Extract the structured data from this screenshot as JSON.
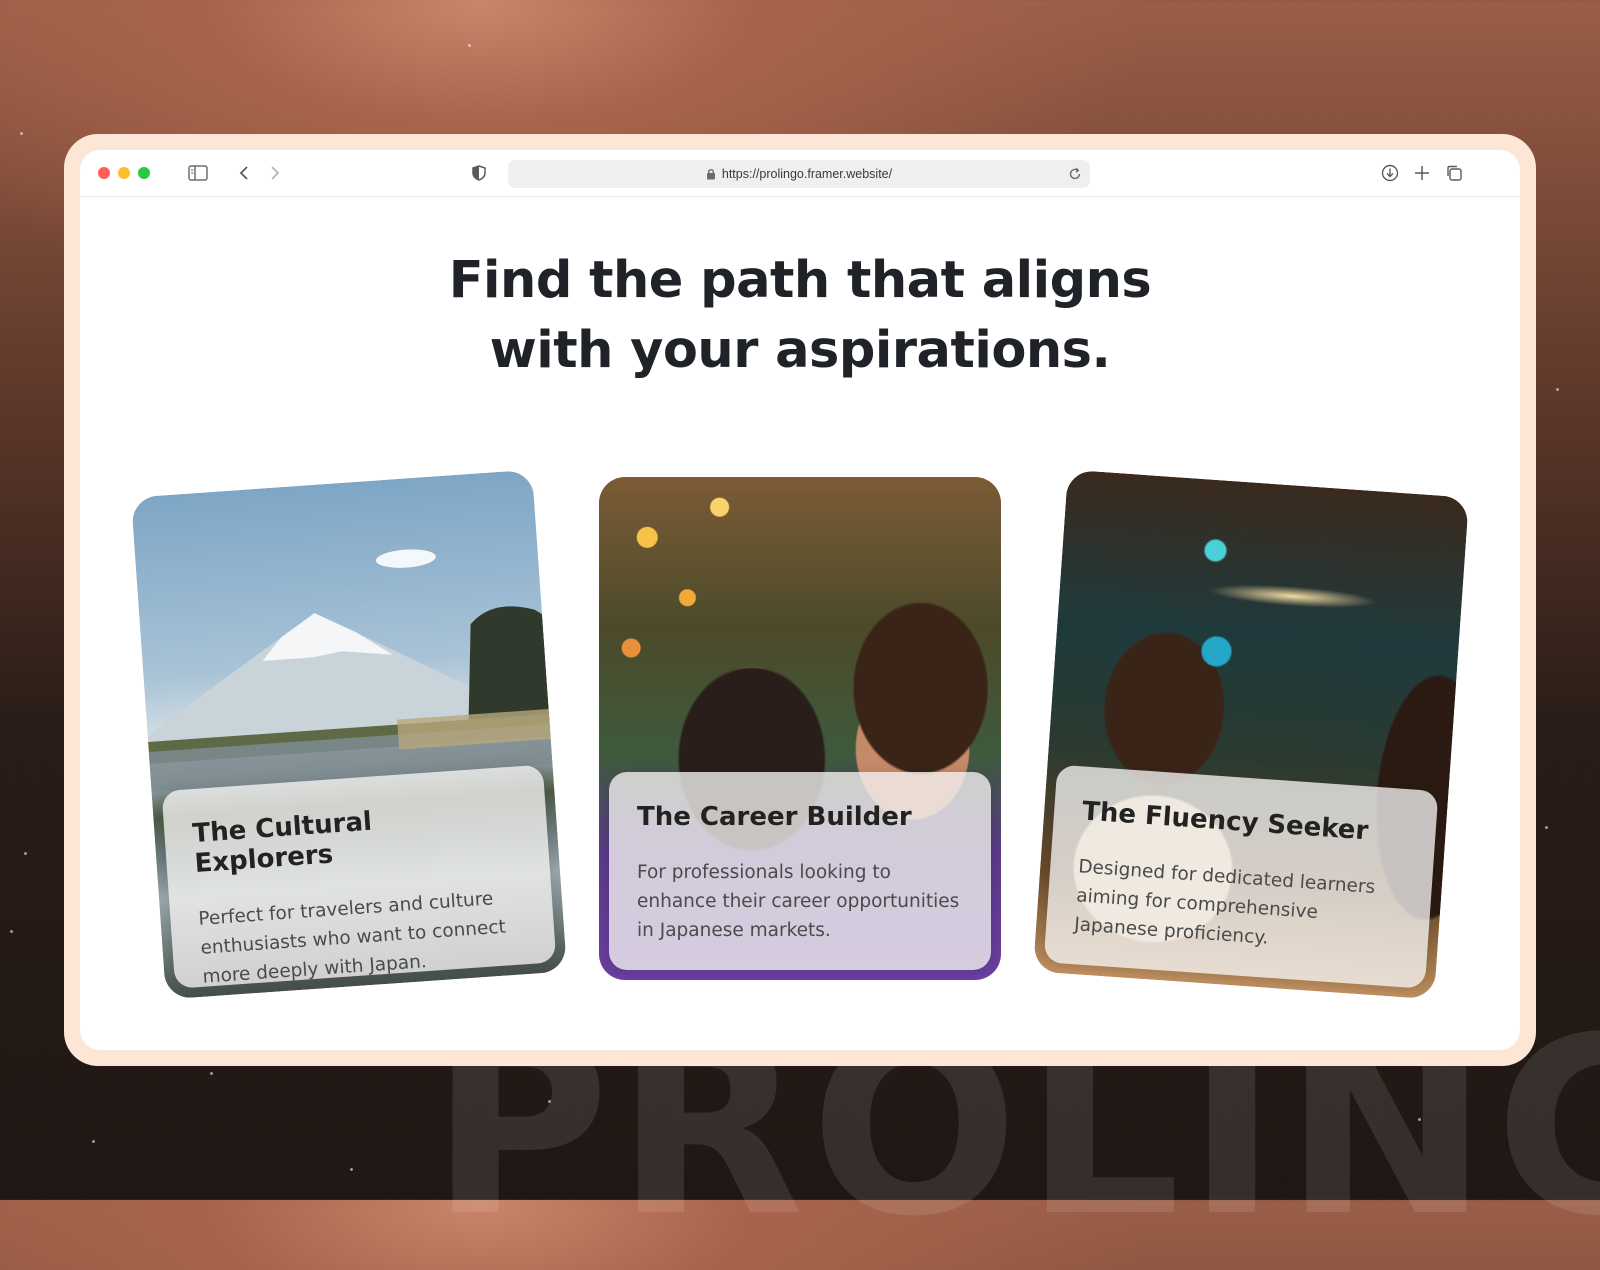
{
  "browser": {
    "url": "https://prolingo.framer.website/",
    "traffic_colors": [
      "#ff5f57",
      "#febc2e",
      "#28c840"
    ]
  },
  "background_watermark": "PROLINGO",
  "headline": {
    "line1": "Find the path that aligns",
    "line2": "with your aspirations."
  },
  "cards": [
    {
      "title": "The Cultural Explorers",
      "description": "Perfect for travelers and culture enthusiasts who want to connect more deeply with Japan.",
      "image": "mount-fuji-lake-photo"
    },
    {
      "title": "The Career Builder",
      "description": "For professionals looking to enhance their career opportunities in Japanese markets.",
      "image": "two-people-studying-cafe-photo"
    },
    {
      "title": "The Fluency Seeker",
      "description": "Designed for dedicated learners aiming for comprehensive Japanese proficiency.",
      "image": "woman-laughing-restaurant-photo"
    }
  ]
}
